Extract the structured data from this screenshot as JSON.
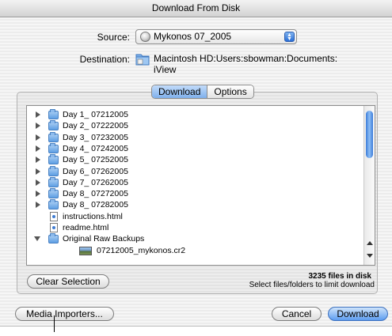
{
  "window": {
    "title": "Download From Disk"
  },
  "source": {
    "label": "Source:",
    "value": "Mykonos 07_2005"
  },
  "destination": {
    "label": "Destination:",
    "path_line1": "Macintosh HD:Users:sbowman:Documents:",
    "path_line2": "iView"
  },
  "tabs": [
    {
      "label": "Download",
      "active": true
    },
    {
      "label": "Options",
      "active": false
    }
  ],
  "browser": {
    "items": [
      {
        "name": "Day 1_ 07212005",
        "type": "folder",
        "expanded": false,
        "indent": 0
      },
      {
        "name": "Day 2_ 07222005",
        "type": "folder",
        "expanded": false,
        "indent": 0
      },
      {
        "name": "Day 3_ 07232005",
        "type": "folder",
        "expanded": false,
        "indent": 0
      },
      {
        "name": "Day 4_ 07242005",
        "type": "folder",
        "expanded": false,
        "indent": 0
      },
      {
        "name": "Day 5_ 07252005",
        "type": "folder",
        "expanded": false,
        "indent": 0
      },
      {
        "name": "Day 6_ 07262005",
        "type": "folder",
        "expanded": false,
        "indent": 0
      },
      {
        "name": "Day 7_ 07262005",
        "type": "folder",
        "expanded": false,
        "indent": 0
      },
      {
        "name": "Day 8_ 07272005",
        "type": "folder",
        "expanded": false,
        "indent": 0
      },
      {
        "name": "Day 8_ 07282005",
        "type": "folder",
        "expanded": false,
        "indent": 0
      },
      {
        "name": "instructions.html",
        "type": "file",
        "expanded": false,
        "indent": 0
      },
      {
        "name": "readme.html",
        "type": "file",
        "expanded": false,
        "indent": 0
      },
      {
        "name": "Original Raw Backups",
        "type": "folder",
        "expanded": true,
        "indent": 0
      },
      {
        "name": "07212005_mykonos.cr2",
        "type": "image",
        "expanded": false,
        "indent": 1
      }
    ]
  },
  "status": {
    "files_count": "3235 files in disk",
    "hint": "Select files/folders to limit download"
  },
  "buttons": {
    "clear_selection": "Clear Selection",
    "media_importers": "Media Importers...",
    "cancel": "Cancel",
    "download": "Download"
  },
  "colors": {
    "accent": "#5d9df0",
    "folder": "#5d9ee3"
  }
}
